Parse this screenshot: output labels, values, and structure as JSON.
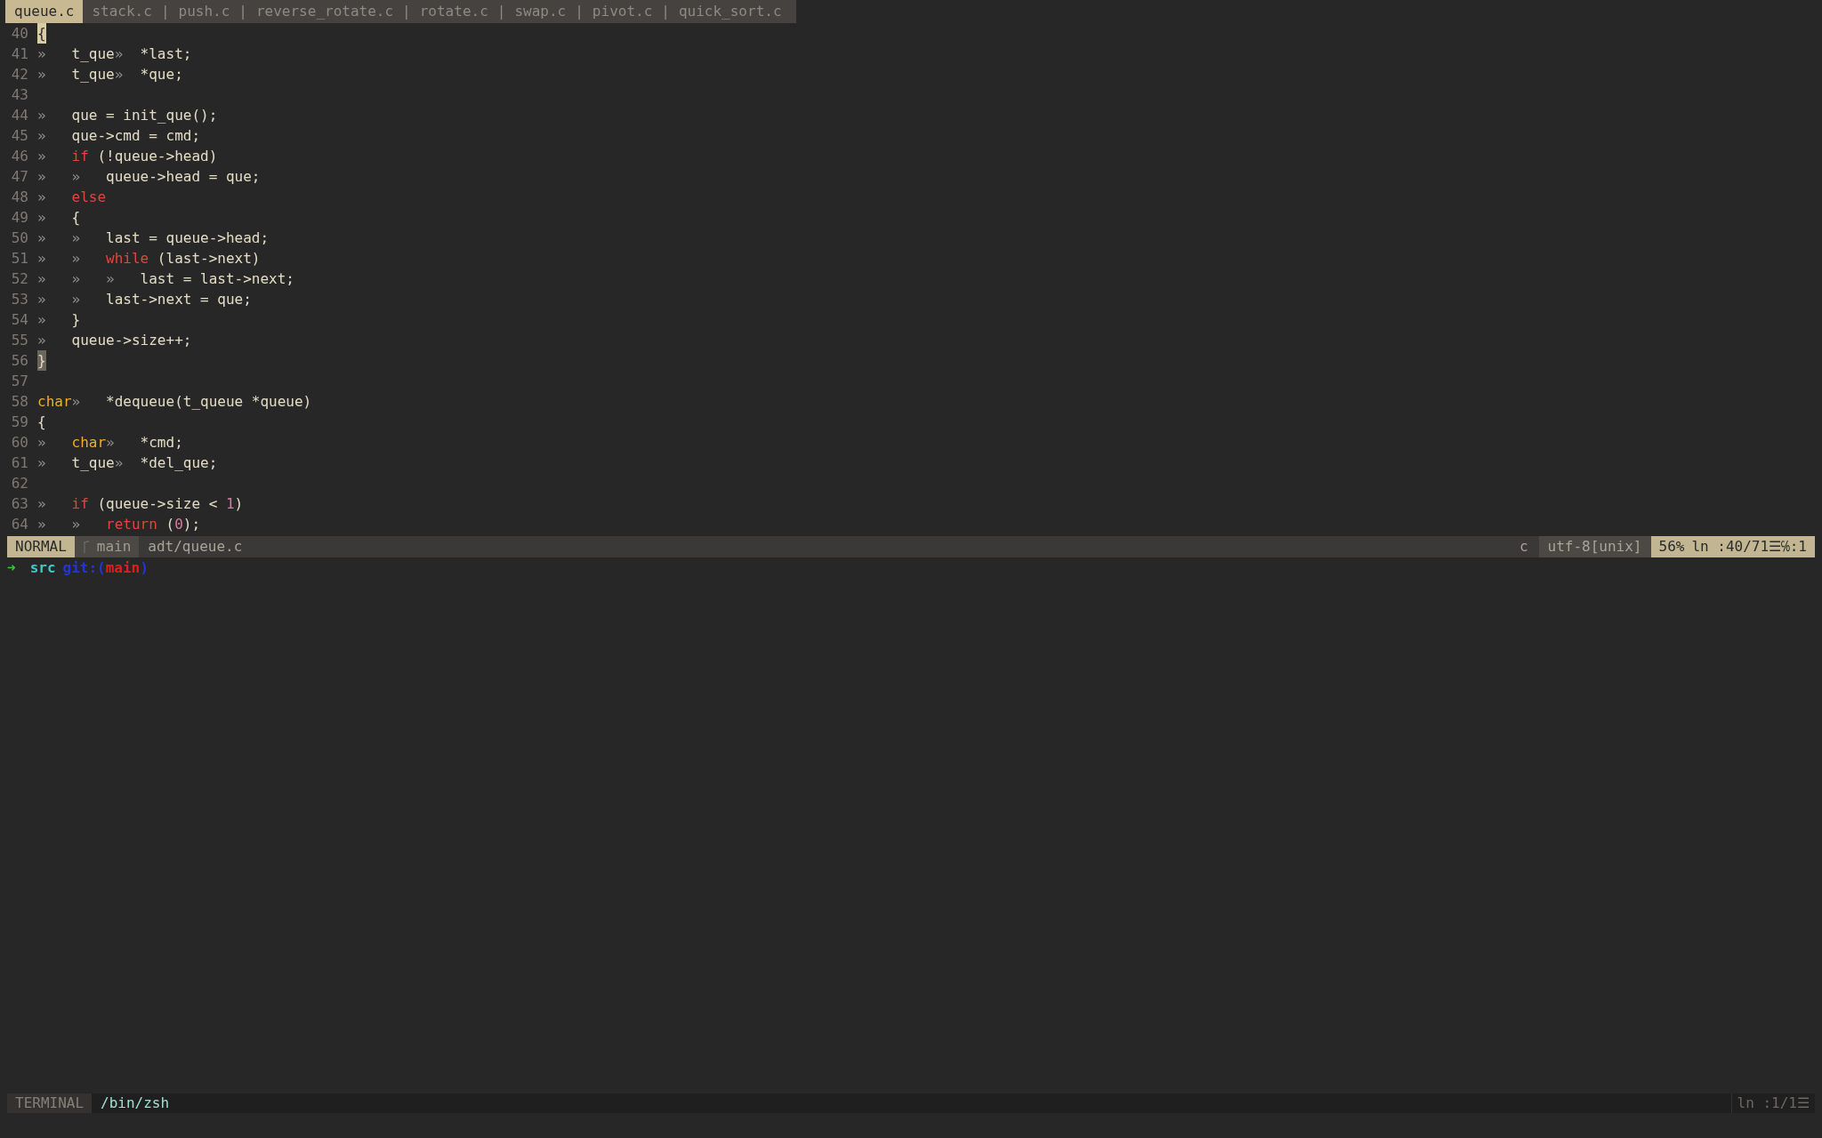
{
  "tabline": {
    "separator": "|",
    "tabs": [
      {
        "label": "queue.c",
        "selected": true
      },
      {
        "label": "stack.c",
        "selected": false
      },
      {
        "label": "push.c",
        "selected": false
      },
      {
        "label": "reverse_rotate.c",
        "selected": false
      },
      {
        "label": "rotate.c",
        "selected": false
      },
      {
        "label": "swap.c",
        "selected": false
      },
      {
        "label": "pivot.c",
        "selected": false
      },
      {
        "label": "quick_sort.c",
        "selected": false
      }
    ]
  },
  "code_lines": [
    {
      "number": "40",
      "tokens": [
        {
          "kind": "cursor",
          "text": "{"
        }
      ]
    },
    {
      "number": "41",
      "tokens": [
        {
          "kind": "tab",
          "text": "»"
        },
        {
          "kind": "text",
          "text": "t_que"
        },
        {
          "kind": "tab",
          "text": "»"
        },
        {
          "kind": "text",
          "text": "*last;"
        }
      ]
    },
    {
      "number": "42",
      "tokens": [
        {
          "kind": "tab",
          "text": "»"
        },
        {
          "kind": "text",
          "text": "t_que"
        },
        {
          "kind": "tab",
          "text": "»"
        },
        {
          "kind": "text",
          "text": "*que;"
        }
      ]
    },
    {
      "number": "43"
    },
    {
      "number": "44",
      "tokens": [
        {
          "kind": "tab",
          "text": "»"
        },
        {
          "kind": "text",
          "text": "que = init_que();"
        }
      ]
    },
    {
      "number": "45",
      "tokens": [
        {
          "kind": "tab",
          "text": "»"
        },
        {
          "kind": "text",
          "text": "que->cmd = cmd;"
        }
      ]
    },
    {
      "number": "46",
      "tokens": [
        {
          "kind": "tab",
          "text": "»"
        },
        {
          "kind": "kw",
          "text": "if"
        },
        {
          "kind": "text",
          "text": " (!queue->head)"
        }
      ]
    },
    {
      "number": "47",
      "tokens": [
        {
          "kind": "tab",
          "text": "»"
        },
        {
          "kind": "tab",
          "text": "»"
        },
        {
          "kind": "text",
          "text": "queue->head = que;"
        }
      ]
    },
    {
      "number": "48",
      "tokens": [
        {
          "kind": "tab",
          "text": "»"
        },
        {
          "kind": "kw",
          "text": "else"
        }
      ]
    },
    {
      "number": "49",
      "tokens": [
        {
          "kind": "tab",
          "text": "»"
        },
        {
          "kind": "text",
          "text": "{"
        }
      ]
    },
    {
      "number": "50",
      "tokens": [
        {
          "kind": "tab",
          "text": "»"
        },
        {
          "kind": "tab",
          "text": "»"
        },
        {
          "kind": "text",
          "text": "last = queue->head;"
        }
      ]
    },
    {
      "number": "51",
      "tokens": [
        {
          "kind": "tab",
          "text": "»"
        },
        {
          "kind": "tab",
          "text": "»"
        },
        {
          "kind": "kw",
          "text": "while"
        },
        {
          "kind": "text",
          "text": " (last->next)"
        }
      ]
    },
    {
      "number": "52",
      "tokens": [
        {
          "kind": "tab",
          "text": "»"
        },
        {
          "kind": "tab",
          "text": "»"
        },
        {
          "kind": "tab",
          "text": "»"
        },
        {
          "kind": "text",
          "text": "last = last->next;"
        }
      ]
    },
    {
      "number": "53",
      "tokens": [
        {
          "kind": "tab",
          "text": "»"
        },
        {
          "kind": "tab",
          "text": "»"
        },
        {
          "kind": "text",
          "text": "last->next = que;"
        }
      ]
    },
    {
      "number": "54",
      "tokens": [
        {
          "kind": "tab",
          "text": "»"
        },
        {
          "kind": "text",
          "text": "}"
        }
      ]
    },
    {
      "number": "55",
      "tokens": [
        {
          "kind": "tab",
          "text": "»"
        },
        {
          "kind": "text",
          "text": "queue->size++;"
        }
      ]
    },
    {
      "number": "56",
      "tokens": [
        {
          "kind": "match",
          "text": "}"
        }
      ]
    },
    {
      "number": "57"
    },
    {
      "number": "58",
      "tokens": [
        {
          "kind": "type",
          "text": "char"
        },
        {
          "kind": "tab",
          "text": "»"
        },
        {
          "kind": "text",
          "text": "*dequeue(t_queue *queue)"
        }
      ]
    },
    {
      "number": "59",
      "tokens": [
        {
          "kind": "text",
          "text": "{"
        }
      ]
    },
    {
      "number": "60",
      "tokens": [
        {
          "kind": "tab",
          "text": "»"
        },
        {
          "kind": "type",
          "text": "char"
        },
        {
          "kind": "tab",
          "text": "»"
        },
        {
          "kind": "text",
          "text": "*cmd;"
        }
      ]
    },
    {
      "number": "61",
      "tokens": [
        {
          "kind": "tab",
          "text": "»"
        },
        {
          "kind": "text",
          "text": "t_que"
        },
        {
          "kind": "tab",
          "text": "»"
        },
        {
          "kind": "text",
          "text": "*del_que;"
        }
      ]
    },
    {
      "number": "62"
    },
    {
      "number": "63",
      "tokens": [
        {
          "kind": "tab",
          "text": "»"
        },
        {
          "kind": "kw",
          "text": "if"
        },
        {
          "kind": "text",
          "text": " (queue->size < "
        },
        {
          "kind": "num",
          "text": "1"
        },
        {
          "kind": "text",
          "text": ")"
        }
      ]
    },
    {
      "number": "64",
      "tokens": [
        {
          "kind": "tab",
          "text": "»"
        },
        {
          "kind": "tab",
          "text": "»"
        },
        {
          "kind": "kw",
          "text": "return"
        },
        {
          "kind": "text",
          "text": " ("
        },
        {
          "kind": "num",
          "text": "0"
        },
        {
          "kind": "text",
          "text": ");"
        }
      ]
    }
  ],
  "status_bar": {
    "mode": "NORMAL",
    "branch": "main",
    "file": "adt/queue.c",
    "filetype": "c",
    "encoding": "utf-8[unix]",
    "percent": "56%",
    "position": "ln :40/71☰℅:1"
  },
  "shell_prompt": {
    "arrow": "➜",
    "directory": "src",
    "git_open": "git:(",
    "branch": "main",
    "git_close": ")"
  },
  "terminal_bar": {
    "label": "TERMINAL",
    "name": "/bin/zsh",
    "position": "ln :1/1☰"
  }
}
